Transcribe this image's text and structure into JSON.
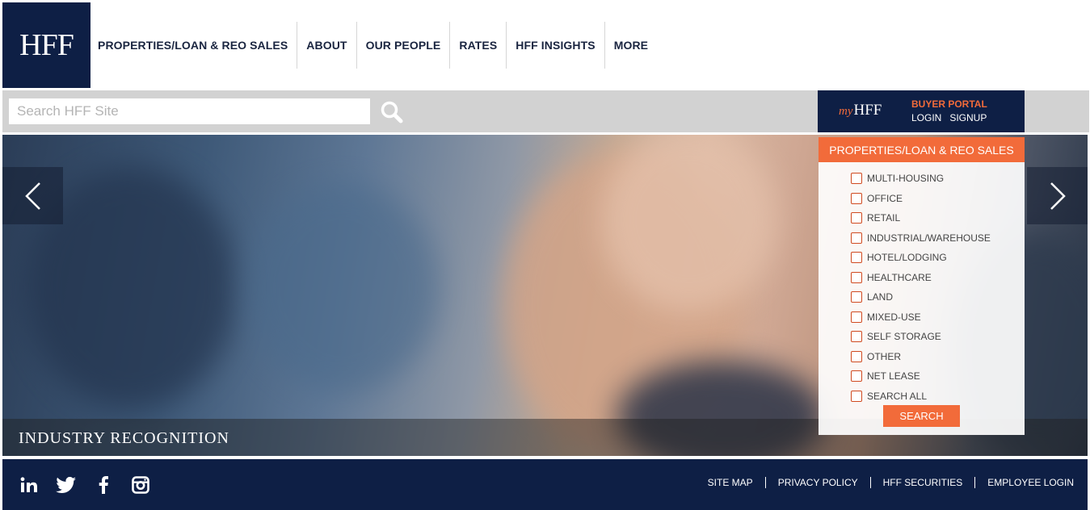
{
  "header": {
    "logo_text": "HFF",
    "nav": [
      {
        "label": "PROPERTIES/LOAN & REO SALES"
      },
      {
        "label": "ABOUT"
      },
      {
        "label": "OUR PEOPLE"
      },
      {
        "label": "RATES"
      },
      {
        "label": "HFF INSIGHTS"
      },
      {
        "label": "MORE"
      }
    ]
  },
  "search": {
    "placeholder": "Search HFF Site",
    "icon": "search-icon"
  },
  "myhff": {
    "logo_prefix": "my",
    "logo_text": "HFF",
    "title": "BUYER PORTAL",
    "login_label": "LOGIN",
    "signup_label": "SIGNUP"
  },
  "hero": {
    "caption": "INDUSTRY RECOGNITION",
    "prev_icon": "chevron-left-icon",
    "next_icon": "chevron-right-icon"
  },
  "property_search": {
    "title": "PROPERTIES/LOAN & REO SALES",
    "options": [
      {
        "label": "MULTI-HOUSING",
        "checked": false
      },
      {
        "label": "OFFICE",
        "checked": false
      },
      {
        "label": "RETAIL",
        "checked": false
      },
      {
        "label": "INDUSTRIAL/WAREHOUSE",
        "checked": false
      },
      {
        "label": "HOTEL/LODGING",
        "checked": false
      },
      {
        "label": "HEALTHCARE",
        "checked": false
      },
      {
        "label": "LAND",
        "checked": false
      },
      {
        "label": "MIXED-USE",
        "checked": false
      },
      {
        "label": "SELF STORAGE",
        "checked": false
      },
      {
        "label": "OTHER",
        "checked": false
      },
      {
        "label": "NET LEASE",
        "checked": false
      },
      {
        "label": "SEARCH ALL",
        "checked": false
      }
    ],
    "button_label": "SEARCH"
  },
  "footer": {
    "social": [
      "linkedin-icon",
      "twitter-icon",
      "facebook-icon",
      "instagram-icon"
    ],
    "links": [
      {
        "label": "SITE MAP"
      },
      {
        "label": "PRIVACY POLICY"
      },
      {
        "label": "HFF SECURITIES"
      },
      {
        "label": "EMPLOYEE LOGIN"
      }
    ]
  },
  "colors": {
    "navy": "#0e1f45",
    "accent": "#f26b3a",
    "search_bar": "#d2d2d2"
  }
}
